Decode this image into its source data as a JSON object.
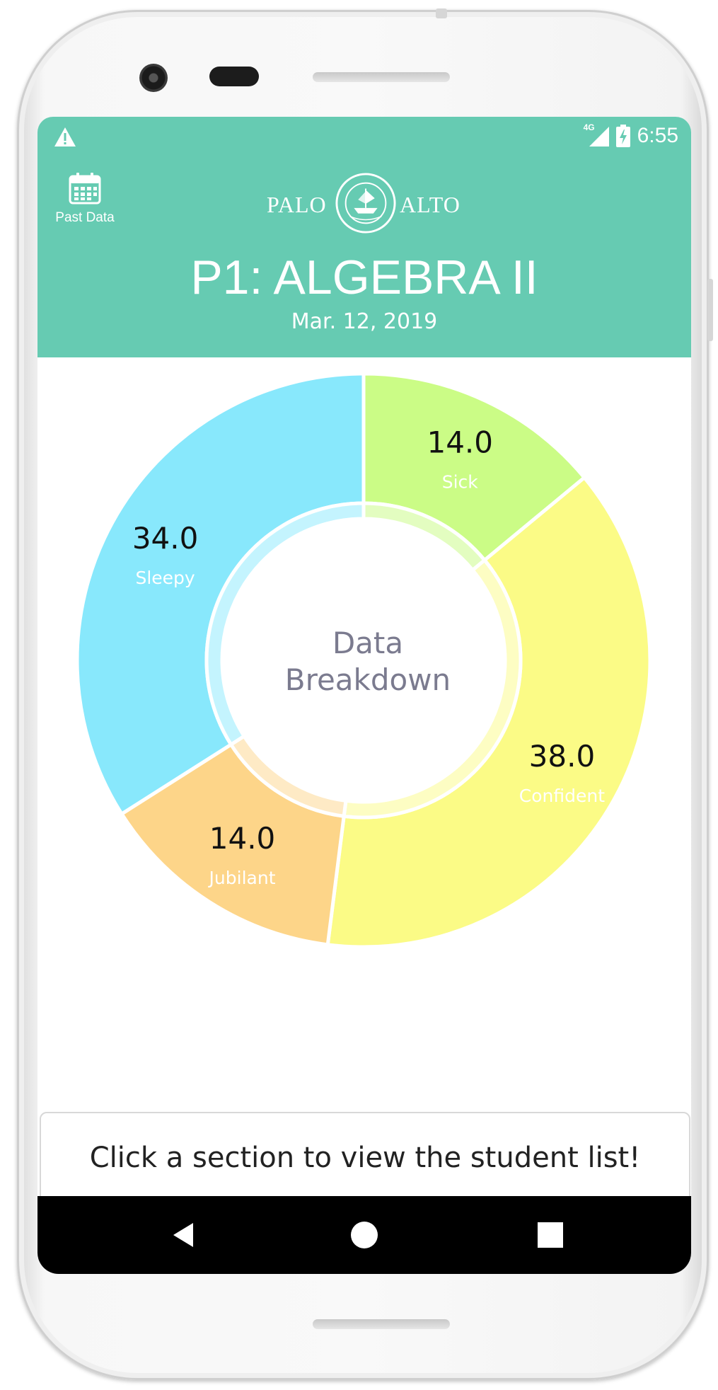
{
  "status_bar": {
    "network": "4G",
    "time": "6:55"
  },
  "header": {
    "past_data_label": "Past Data",
    "logo_left": "PALO",
    "logo_right": "ALTO",
    "title": "P1: ALGEBRA II",
    "date": "Mar. 12, 2019"
  },
  "colors": {
    "header": "#66cbb2",
    "sick": "#cbfc86",
    "confident": "#fbfb86",
    "jubilant": "#fdd589",
    "sleepy": "#88e8fc"
  },
  "chart_data": {
    "type": "pie",
    "center_label": [
      "Data",
      "Breakdown"
    ],
    "slices": [
      {
        "label": "Sick",
        "value": 14.0,
        "display": "14.0",
        "color": "#cbfc86",
        "ring": "#e3fdc0"
      },
      {
        "label": "Confident",
        "value": 38.0,
        "display": "38.0",
        "color": "#fbfb86",
        "ring": "#fdfdc3"
      },
      {
        "label": "Jubilant",
        "value": 14.0,
        "display": "14.0",
        "color": "#fdd589",
        "ring": "#feeac5"
      },
      {
        "label": "Sleepy",
        "value": 34.0,
        "display": "34.0",
        "color": "#88e8fc",
        "ring": "#c4f4fe"
      }
    ]
  },
  "footer": {
    "prompt": "Click a section to view the student list!"
  },
  "navbar": {
    "back": "back-icon",
    "home": "home-icon",
    "recents": "recents-icon"
  }
}
